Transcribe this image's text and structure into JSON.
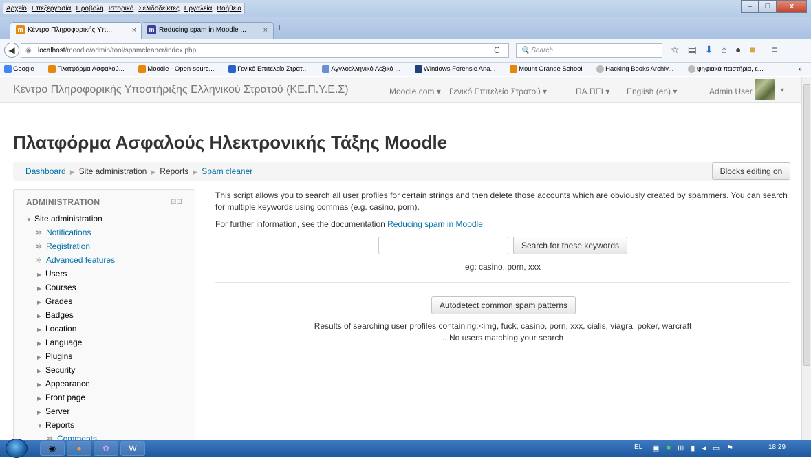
{
  "browser": {
    "menu": [
      "Αρχείο",
      "Επεξεργασία",
      "Προβολή",
      "Ιστορικό",
      "Σελιδοδείκτες",
      "Εργαλεία",
      "Βοήθεια"
    ],
    "window_controls": {
      "minimize": "–",
      "maximize": "□",
      "close": "x"
    },
    "tabs": [
      {
        "title": "Κέντρο Πληροφορικής Υπ...",
        "icon": "moodle-icon",
        "active": true
      },
      {
        "title": "Reducing spam in Moodle ...",
        "icon": "moodle-docs-icon",
        "active": false
      }
    ],
    "tab_close": "×",
    "new_tab": "+",
    "url_host": "localhost",
    "url_path": "/moodle/admin/tool/spamcleaner/index.php",
    "search_placeholder": "Search",
    "bookmarks": [
      "Google",
      "Πλατφόρμα Ασφαλού...",
      "Moodle - Open-sourc...",
      "Γενικό Επιτελείο Στρατ...",
      "Αγγλοελληνικό Λεξικό ...",
      "Windows Forensic Ana...",
      "Mount Orange School",
      "Hacking Books Archiv...",
      "ψηφιακά πειστήρια, ε..."
    ],
    "bookmarks_overflow": "»"
  },
  "moodle": {
    "brand": "Κέντρο Πληροφορικής Υποστήριξης Ελληνικού Στρατού (ΚΕ.Π.Υ.Ε.Σ)",
    "nav": [
      "Moodle.com ▾",
      "Γενικό Επιτελείο Στρατού ▾",
      "ΠΑ.ΠΕΙ ▾",
      "English (en) ▾"
    ],
    "user": "Admin User",
    "user_caret": "▾",
    "heading": "Πλατφόρμα Ασφαλούς Ηλεκτρονικής Τάξης Moodle",
    "breadcrumb": {
      "dashboard": "Dashboard",
      "site_admin": "Site administration",
      "reports": "Reports",
      "current": "Spam cleaner"
    },
    "blocks_editing": "Blocks editing on"
  },
  "sidebar": {
    "title": "ADMINISTRATION",
    "root": "Site administration",
    "links": [
      "Notifications",
      "Registration",
      "Advanced features"
    ],
    "folders": [
      "Users",
      "Courses",
      "Grades",
      "Badges",
      "Location",
      "Language",
      "Plugins",
      "Security",
      "Appearance",
      "Front page",
      "Server"
    ],
    "reports": "Reports",
    "report_links": [
      "Comments"
    ]
  },
  "main": {
    "intro": "This script allows you to search all user profiles for certain strings and then delete those accounts which are obviously created by spammers. You can search for multiple keywords using commas (e.g. casino, porn).",
    "further_prefix": "For further information, see the documentation ",
    "further_link": "Reducing spam in Moodle.",
    "search_button": "Search for these keywords",
    "example": "eg: casino, porn, xxx",
    "autodetect_button": "Autodetect common spam patterns",
    "results": "Results of searching user profiles containing:<img, fuck, casino, porn, xxx, cialis, viagra, poker, warcraft",
    "no_users": "...No users matching your search"
  },
  "taskbar": {
    "lang": "EL",
    "time": "18:29"
  },
  "colors": {
    "link": "#0070a8",
    "taskbar": "#1f5aa0"
  }
}
